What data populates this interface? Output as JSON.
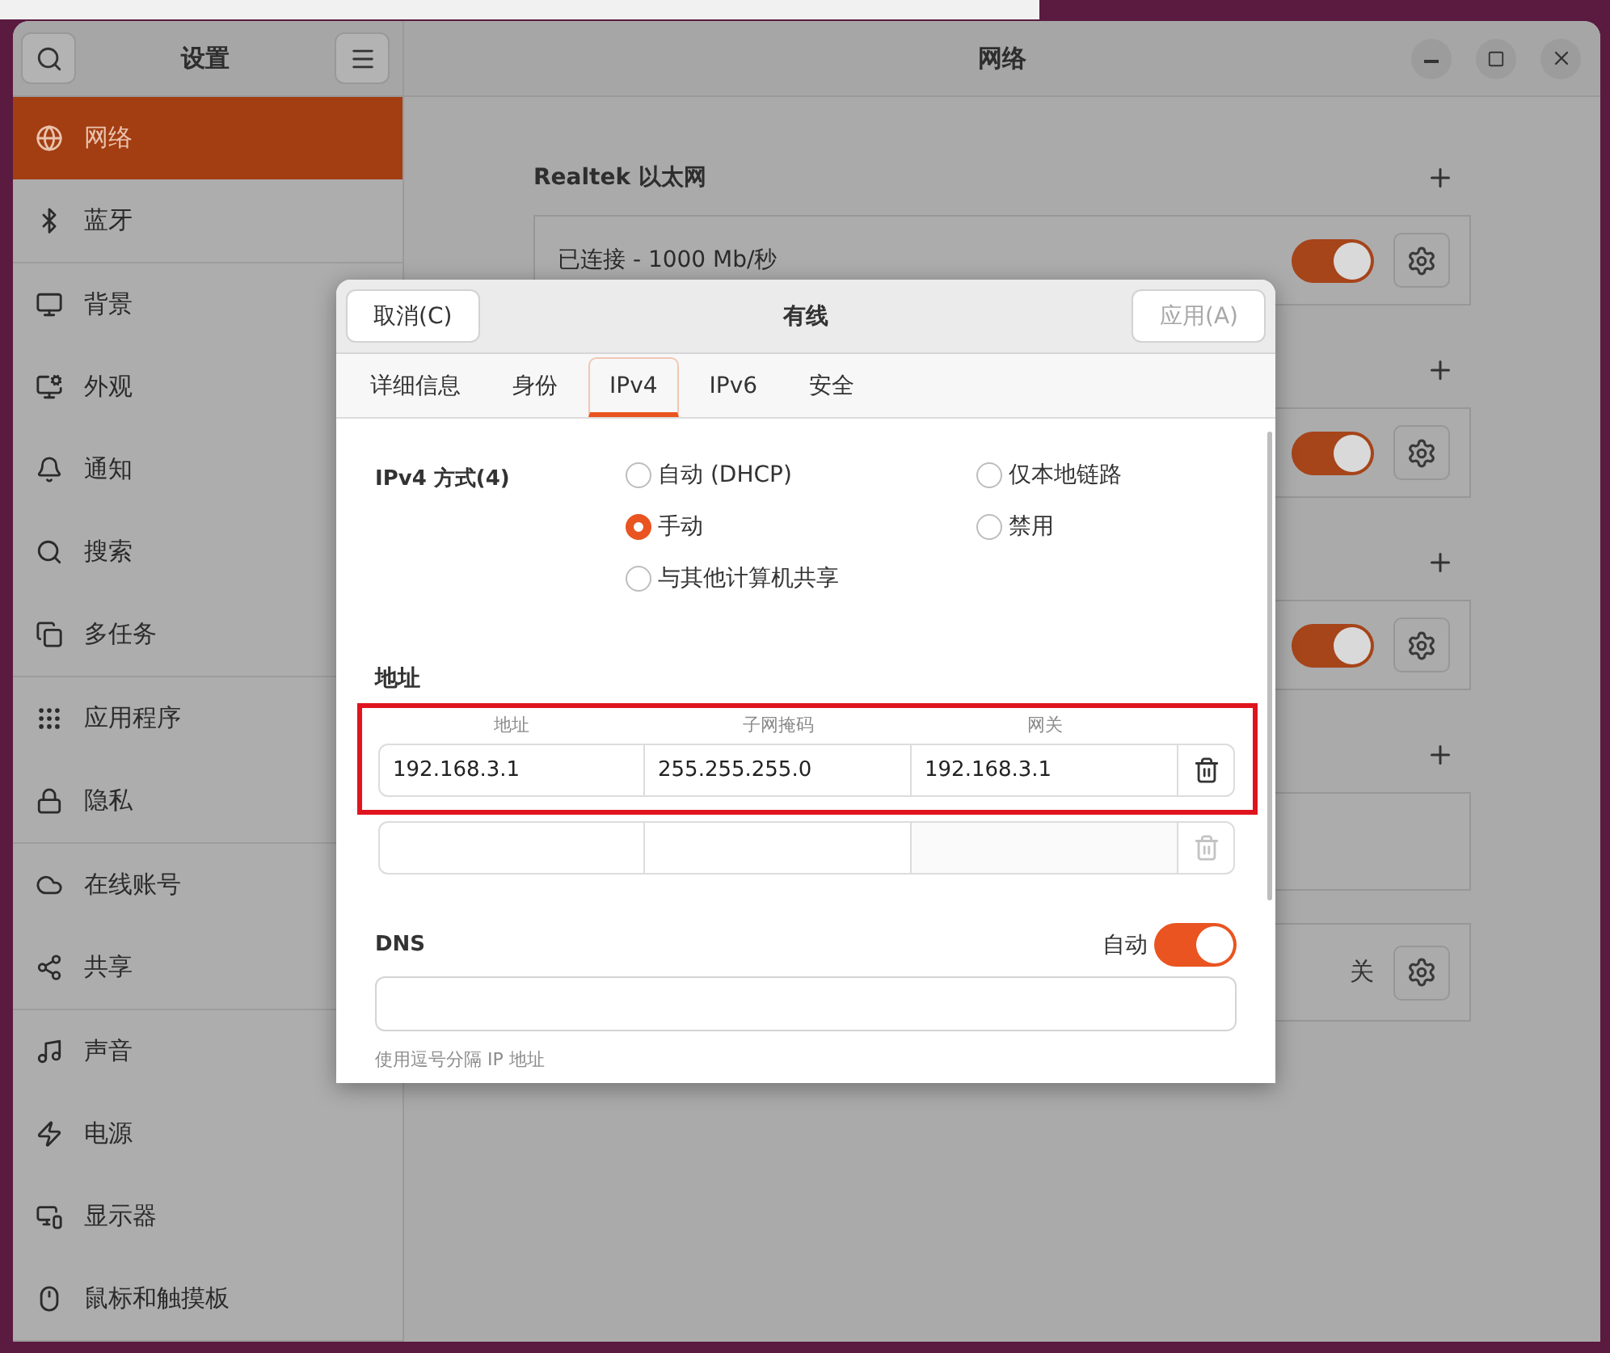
{
  "window": {
    "title": "设置",
    "page_title": "网络"
  },
  "sidebar": {
    "groups": [
      [
        {
          "label": "网络",
          "selected": true
        },
        {
          "label": "蓝牙",
          "selected": false
        }
      ],
      [
        {
          "label": "背景",
          "selected": false
        },
        {
          "label": "外观",
          "selected": false
        },
        {
          "label": "通知",
          "selected": false
        },
        {
          "label": "搜索",
          "selected": false
        },
        {
          "label": "多任务",
          "selected": false
        }
      ],
      [
        {
          "label": "应用程序",
          "selected": false
        },
        {
          "label": "隐私",
          "selected": false
        }
      ],
      [
        {
          "label": "在线账号",
          "selected": false
        },
        {
          "label": "共享",
          "selected": false
        }
      ],
      [
        {
          "label": "声音",
          "selected": false
        },
        {
          "label": "电源",
          "selected": false
        },
        {
          "label": "显示器",
          "selected": false
        },
        {
          "label": "鼠标和触摸板",
          "selected": false
        }
      ]
    ]
  },
  "network": {
    "sections": [
      {
        "title": "Realtek 以太网",
        "rows": [
          {
            "kind": "switch",
            "status": "已连接 - 1000 Mb/秒",
            "on": true
          }
        ]
      },
      {
        "rows": [
          {
            "kind": "switch",
            "on": true
          }
        ]
      },
      {
        "rows": [
          {
            "kind": "switch",
            "on": true
          }
        ]
      },
      {
        "rows": [
          {
            "kind": "blank"
          },
          {
            "kind": "state",
            "state": "关"
          }
        ]
      }
    ]
  },
  "dialog": {
    "title": "有线",
    "cancel": {
      "label": "取消(C)"
    },
    "apply": {
      "label": "应用(A)",
      "disabled": true
    },
    "tabs": [
      {
        "label": "详细信息",
        "selected": false
      },
      {
        "label": "身份",
        "selected": false
      },
      {
        "label": "IPv4",
        "selected": true
      },
      {
        "label": "IPv6",
        "selected": false
      },
      {
        "label": "安全",
        "selected": false
      }
    ],
    "method": {
      "label": "IPv4 方式(4)",
      "options": [
        {
          "label": "自动 (DHCP)",
          "selected": false
        },
        {
          "label": "仅本地链路",
          "selected": false
        },
        {
          "label": "手动",
          "selected": true
        },
        {
          "label": "禁用",
          "selected": false
        },
        {
          "label": "与其他计算机共享",
          "selected": false
        }
      ]
    },
    "addresses": {
      "label": "地址",
      "columns": [
        "地址",
        "子网掩码",
        "网关"
      ],
      "rows": [
        {
          "cells": [
            "192.168.3.1",
            "255.255.255.0",
            "192.168.3.1"
          ],
          "disabled": false
        },
        {
          "disabled": true
        }
      ]
    },
    "dns": {
      "label": "DNS",
      "auto_label": "自动",
      "auto_on": true,
      "hint": "使用逗号分隔 IP 地址"
    }
  }
}
